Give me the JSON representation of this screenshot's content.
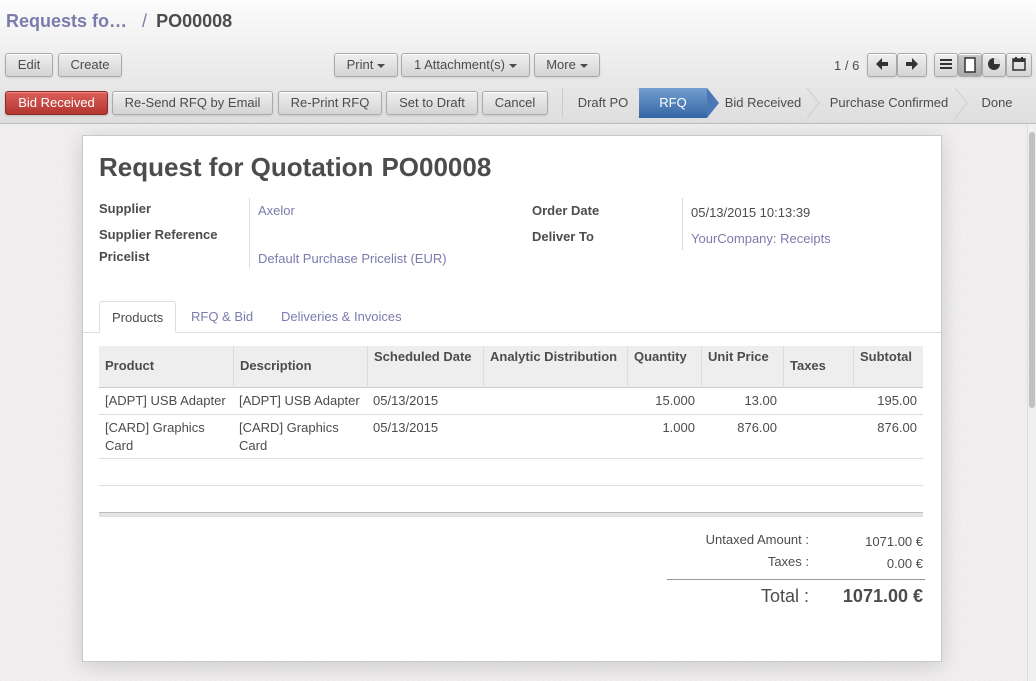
{
  "breadcrumb": {
    "parent": "Requests fo…",
    "separator": "/",
    "current": "PO00008"
  },
  "toolbar": {
    "edit": "Edit",
    "create": "Create",
    "print": "Print",
    "attachments": "1 Attachment(s)",
    "more": "More",
    "pager": "1 / 6"
  },
  "actions": {
    "bid_received": "Bid Received",
    "resend_rfq": "Re-Send RFQ by Email",
    "reprint_rfq": "Re-Print RFQ",
    "set_to_draft": "Set to Draft",
    "cancel": "Cancel"
  },
  "stages": [
    "Draft PO",
    "RFQ",
    "Bid Received",
    "Purchase Confirmed",
    "Done"
  ],
  "active_stage": "RFQ",
  "document": {
    "title": "Request for Quotation",
    "number": "PO00008",
    "supplier_label": "Supplier",
    "supplier": "Axelor",
    "supplier_ref_label": "Supplier Reference",
    "pricelist_label": "Pricelist",
    "pricelist": "Default Purchase Pricelist (EUR)",
    "order_date_label": "Order Date",
    "order_date": "05/13/2015 10:13:39",
    "deliver_to_label": "Deliver To",
    "deliver_to": "YourCompany: Receipts"
  },
  "tabs": [
    "Products",
    "RFQ & Bid",
    "Deliveries & Invoices"
  ],
  "table": {
    "headers": [
      "Product",
      "Description",
      "Scheduled Date",
      "Analytic Distribution",
      "Quantity",
      "Unit Price",
      "Taxes",
      "Subtotal"
    ],
    "rows": [
      {
        "product_1": "[ADPT] USB Adapter",
        "product_2": "",
        "description_1": "[ADPT] USB Adapter",
        "description_2": "",
        "date": "05/13/2015",
        "analytic": "",
        "quantity": "15.000",
        "unit_price": "13.00",
        "taxes": "",
        "subtotal": "195.00"
      },
      {
        "product_1": "[CARD] Graphics",
        "product_2": "Card",
        "description_1": "[CARD] Graphics",
        "description_2": "Card",
        "date": "05/13/2015",
        "analytic": "",
        "quantity": "1.000",
        "unit_price": "876.00",
        "taxes": "",
        "subtotal": "876.00"
      }
    ]
  },
  "totals": {
    "untaxed_label": "Untaxed Amount :",
    "untaxed_value": "1071.00 €",
    "taxes_label": "Taxes :",
    "taxes_value": "0.00 €",
    "total_label": "Total :",
    "total_value": "1071.00 €"
  },
  "colors": {
    "accent": "#7c7bad",
    "primary_button": "#b33630",
    "active_stage": "#3465a4"
  }
}
